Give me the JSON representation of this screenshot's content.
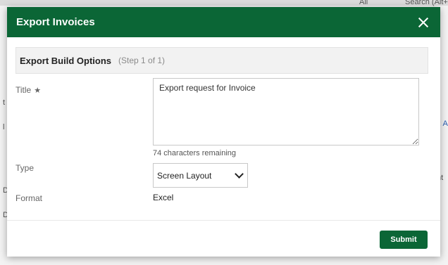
{
  "background": {
    "hint_a": "All",
    "hint_b": "Search (Alt+",
    "hint_link": "t: A",
    "hint_c": "nt",
    "hint_d": "D",
    "hint_e": "D",
    "hint_f": "t",
    "hint_g": "l"
  },
  "modal": {
    "title": "Export Invoices",
    "close_icon": "close-icon",
    "section": {
      "title": "Export Build Options",
      "step": "(Step 1 of 1)"
    },
    "form": {
      "title_label": "Title",
      "title_required_mark": "★",
      "title_value": "Export request for Invoice",
      "char_count": "74 characters remaining",
      "type_label": "Type",
      "type_selected": "Screen Layout",
      "format_label": "Format",
      "format_value": "Excel"
    },
    "submit_label": "Submit"
  },
  "colors": {
    "header_bg": "#0b6636",
    "button_bg": "#0b6636"
  }
}
